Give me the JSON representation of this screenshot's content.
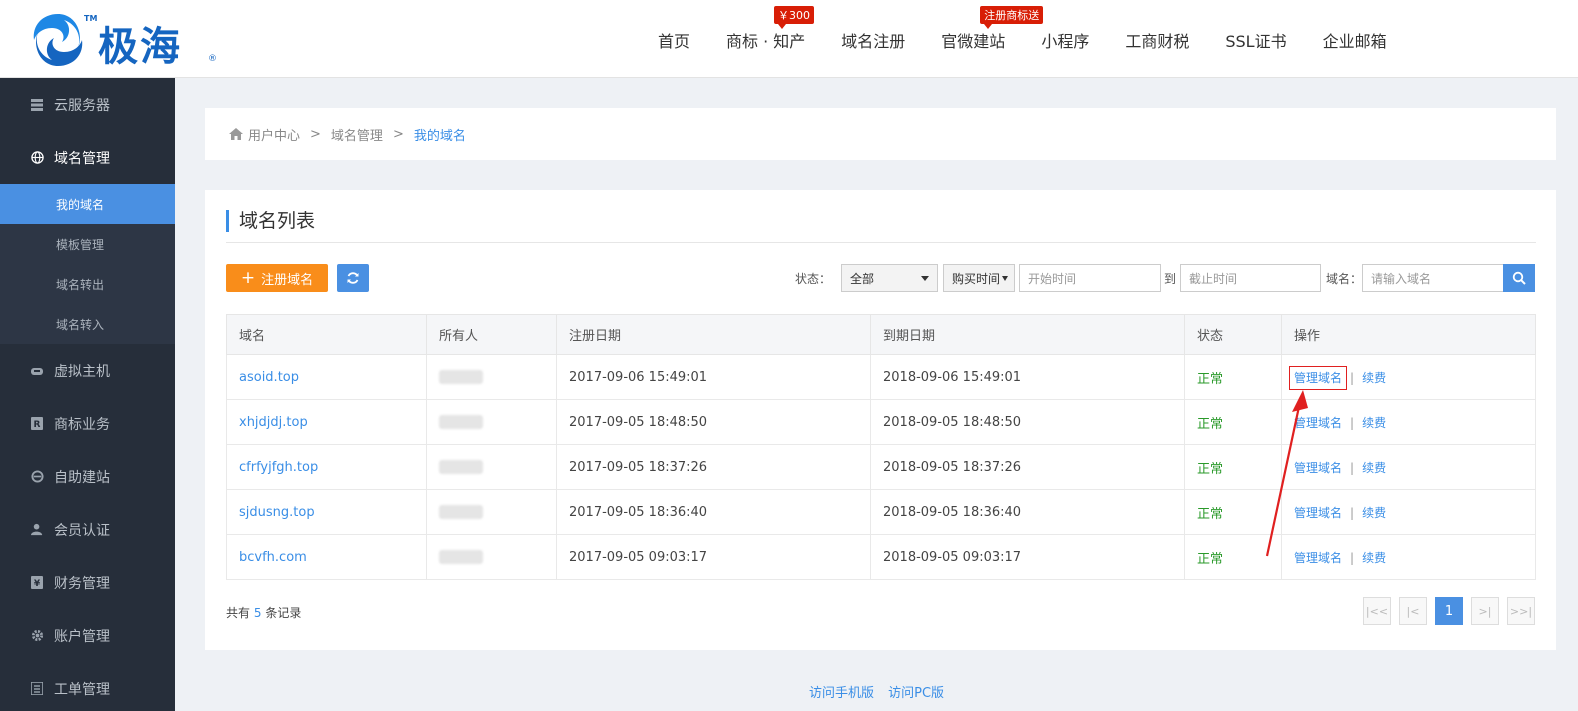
{
  "brand": {
    "name": "极海",
    "tm": "TM",
    "reg": "®"
  },
  "nav": {
    "items": [
      {
        "label": "首页"
      },
      {
        "label": "商标 · 知产",
        "badge": "￥300"
      },
      {
        "label": "域名注册"
      },
      {
        "label": "官微建站",
        "badge": "注册商标送"
      },
      {
        "label": "小程序"
      },
      {
        "label": "工商财税"
      },
      {
        "label": "SSL证书"
      },
      {
        "label": "企业邮箱"
      }
    ]
  },
  "sidebar": {
    "items": [
      {
        "label": "云服务器",
        "icon": "server-icon"
      },
      {
        "label": "域名管理",
        "icon": "globe-icon"
      },
      {
        "label": "虚拟主机",
        "icon": "cloud-icon"
      },
      {
        "label": "商标业务",
        "icon": "registered-icon"
      },
      {
        "label": "自助建站",
        "icon": "ie-icon"
      },
      {
        "label": "会员认证",
        "icon": "user-icon"
      },
      {
        "label": "财务管理",
        "icon": "yen-icon"
      },
      {
        "label": "账户管理",
        "icon": "gear-icon"
      },
      {
        "label": "工单管理",
        "icon": "list-icon"
      }
    ],
    "sub": [
      {
        "label": "我的域名"
      },
      {
        "label": "模板管理"
      },
      {
        "label": "域名转出"
      },
      {
        "label": "域名转入"
      }
    ]
  },
  "breadcrumb": {
    "home": "用户中心",
    "mid": "域名管理",
    "current": "我的域名",
    "sep": ">"
  },
  "card": {
    "title": "域名列表"
  },
  "toolbar": {
    "register_label": "注册域名",
    "status_label": "状态：",
    "status_value": "全部",
    "time_select": "购买时间",
    "start_placeholder": "开始时间",
    "to_label": "到",
    "end_placeholder": "截止时间",
    "domain_label": "域名：",
    "domain_placeholder": "请输入域名"
  },
  "table": {
    "headers": [
      "域名",
      "所有人",
      "注册日期",
      "到期日期",
      "状态",
      "操作"
    ],
    "manage_label": "管理域名",
    "renew_label": "续费",
    "op_sep": "|",
    "rows": [
      {
        "domain": "asoid.top",
        "reg": "2017-09-06 15:49:01",
        "exp": "2018-09-06 15:49:01",
        "status": "正常"
      },
      {
        "domain": "xhjdjdj.top",
        "reg": "2017-09-05 18:48:50",
        "exp": "2018-09-05 18:48:50",
        "status": "正常"
      },
      {
        "domain": "cfrfyjfgh.top",
        "reg": "2017-09-05 18:37:26",
        "exp": "2018-09-05 18:37:26",
        "status": "正常"
      },
      {
        "domain": "sjdusng.top",
        "reg": "2017-09-05 18:36:40",
        "exp": "2018-09-05 18:36:40",
        "status": "正常"
      },
      {
        "domain": "bcvfh.com",
        "reg": "2017-09-05 09:03:17",
        "exp": "2018-09-05 09:03:17",
        "status": "正常"
      }
    ]
  },
  "summary": {
    "prefix": "共有",
    "count": "5",
    "suffix": "条记录"
  },
  "pager": {
    "current": "1"
  },
  "footer": {
    "mobile": "访问手机版",
    "pc": "访问PC版"
  },
  "colors": {
    "accent": "#4a90e2",
    "orange": "#f98d1a",
    "sidebar": "#262e3a",
    "ok": "#2a9a2a",
    "badge": "#d81e06"
  }
}
